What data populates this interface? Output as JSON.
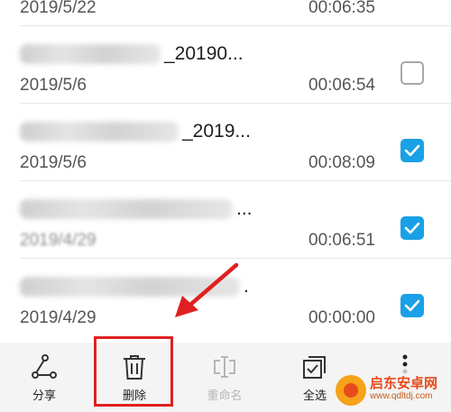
{
  "list": {
    "partial_top": {
      "date": "2019/5/22",
      "time": "00:06:35"
    },
    "items": [
      {
        "name_suffix": "_20190...",
        "date": "2019/5/6",
        "time": "00:06:54",
        "checked": false
      },
      {
        "name_suffix": "_2019...",
        "date": "2019/5/6",
        "time": "00:08:09",
        "checked": true
      },
      {
        "name_suffix": "...",
        "date": "2019/4/29",
        "time": "00:06:51",
        "checked": true
      },
      {
        "name_suffix": ".",
        "date": "2019/4/29",
        "time": "00:00:00",
        "checked": true
      }
    ]
  },
  "toolbar": {
    "share_label": "分享",
    "delete_label": "删除",
    "rename_label": "重命名",
    "select_all_label": "全选"
  },
  "watermark": {
    "cn": "启东安卓网",
    "url": "www.qdltdj.com"
  },
  "colors": {
    "accent": "#1aa0e6",
    "highlight": "#e02020"
  }
}
